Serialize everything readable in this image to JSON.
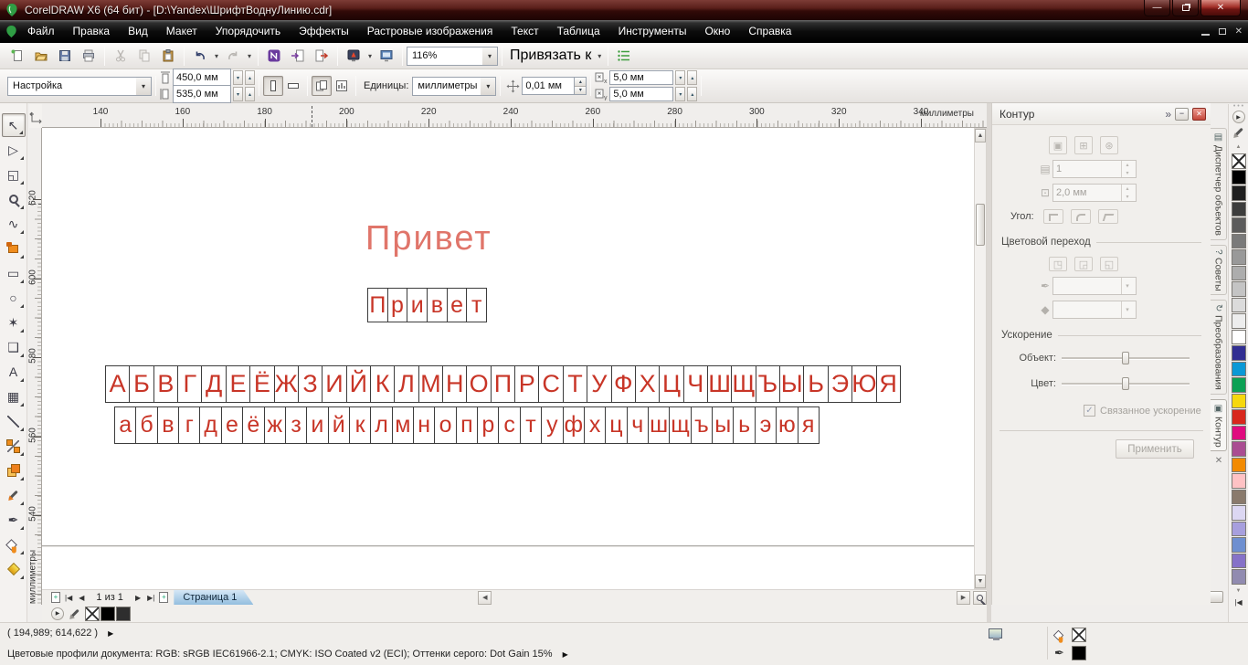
{
  "window": {
    "title": "CorelDRAW X6 (64 бит) - [D:\\Yandex\\ШрифтВоднуЛинию.cdr]"
  },
  "icons": {
    "minimize": "—",
    "close": "✕",
    "dropdown": "▾",
    "spin_up": "▴",
    "spin_down": "▾",
    "chevrons": "»",
    "next_marker": "▶",
    "flyout": "▶",
    "nav_first": "|◀",
    "nav_prev": "◀",
    "nav_next": "▶",
    "nav_last": "▶|",
    "page_add": "+",
    "scroll_left": "◀",
    "scroll_right": "▶",
    "scroll_up": "▲",
    "scroll_down": "▼",
    "expand": "|◀",
    "check": "✓",
    "grip": "• • •",
    "tab_close": "✕"
  },
  "menu": {
    "items": [
      "Файл",
      "Правка",
      "Вид",
      "Макет",
      "Упорядочить",
      "Эффекты",
      "Растровые изображения",
      "Текст",
      "Таблица",
      "Инструменты",
      "Окно",
      "Справка"
    ]
  },
  "stdbar": {
    "zoom_value": "116%",
    "snap_label": "Привязать к"
  },
  "propbar": {
    "preset": "Настройка",
    "page_width": "450,0 мм",
    "page_height": "535,0 мм",
    "units_label": "Единицы:",
    "units_value": "миллиметры",
    "nudge_value": "0,01 мм",
    "dup_x": "5,0 мм",
    "dup_y": "5,0 мм"
  },
  "rulers": {
    "h_numbers": [
      140,
      160,
      180,
      200,
      220,
      240,
      260,
      280,
      300,
      320,
      340
    ],
    "v_numbers": [
      620,
      600,
      580,
      560,
      540
    ],
    "unit": "миллиметры"
  },
  "toolbox": {
    "tools": [
      {
        "id": "pick-tool",
        "glyph": "↖"
      },
      {
        "id": "shape-tool",
        "glyph": "▷"
      },
      {
        "id": "crop-tool",
        "glyph": "◱"
      },
      {
        "id": "zoom-tool",
        "cls": "i-zoom"
      },
      {
        "id": "freehand-tool",
        "glyph": "∿"
      },
      {
        "id": "smart-fill-tool",
        "cls": "i-smartfill"
      },
      {
        "id": "rectangle-tool",
        "glyph": "▭"
      },
      {
        "id": "ellipse-tool",
        "glyph": "○"
      },
      {
        "id": "polygon-tool",
        "glyph": "✶"
      },
      {
        "id": "basic-shapes-tool",
        "glyph": "❑"
      },
      {
        "id": "text-tool",
        "glyph": "А"
      },
      {
        "id": "table-tool",
        "glyph": "▦"
      },
      {
        "id": "dimension-tool",
        "cls": "i-dim"
      },
      {
        "id": "connector-tool",
        "cls": "i-conn"
      },
      {
        "id": "blend-tool",
        "cls": "i-blend"
      },
      {
        "id": "eyedropper-tool",
        "cls": "i-dropper"
      },
      {
        "id": "outline-pen-tool",
        "glyph": "✒"
      },
      {
        "id": "fill-tool",
        "cls": "i-bucket"
      },
      {
        "id": "interactive-fill-tool",
        "cls": "i-ifill"
      }
    ]
  },
  "canvas": {
    "hello_plain": "Привет",
    "hello_boxed": "Привет",
    "alphabet_upper": "АБВГДЕЁЖЗИЙКЛМНОПРСТУФХЦЧШЩЪЫЬЭЮЯ",
    "alphabet_lower": "абвгдеёжзийклмнопрстуфхцчшщъыьэюя",
    "text_color": "#c83527",
    "plain_color": "#e0756a"
  },
  "page_nav": {
    "counter": "1 из 1",
    "tab_label": "Страница 1"
  },
  "docker": {
    "title": "Контур",
    "steps_value": "1",
    "offset_value": "2,0 мм",
    "corner_label": "Угол:",
    "section_color": "Цветовой переход",
    "section_accel": "Ускорение",
    "object_label": "Объект:",
    "color_label": "Цвет:",
    "linked_accel_label": "Связанное ускорение",
    "apply_label": "Применить",
    "tabs": [
      {
        "id": "object-manager",
        "label": "Диспетчер объектов",
        "glyph": "▤"
      },
      {
        "id": "hints",
        "label": "Советы",
        "glyph": "?"
      },
      {
        "id": "transformations",
        "label": "Преобразования",
        "glyph": "↻"
      },
      {
        "id": "contour",
        "label": "Контур",
        "glyph": "▣",
        "active": true
      }
    ]
  },
  "palette": {
    "colors": [
      "none",
      "#000000",
      "#1f1f1f",
      "#3d3d3d",
      "#5c5c5c",
      "#7a7a7a",
      "#999999",
      "#adadad",
      "#c4c4c4",
      "#dbdbdb",
      "#ededed",
      "#ffffff",
      "#312e92",
      "#0b99d6",
      "#0ca154",
      "#f6d80e",
      "#d8271c",
      "#e00b7f",
      "#aa4d92",
      "#f28a00",
      "#ffc2c4",
      "#8a7a6c",
      "#dcd7f2",
      "#a79fdd",
      "#6e8fd0",
      "#8672c8",
      "#918bb0"
    ],
    "document_colors": [
      "none",
      "#000000",
      "#2e2e2e"
    ]
  },
  "status": {
    "coords": "( 194,989; 614,622 )",
    "profiles": "Цветовые профили документа: RGB: sRGB IEC61966-2.1; CMYK: ISO Coated v2 (ECI); Оттенки серого: Dot Gain 15%"
  }
}
